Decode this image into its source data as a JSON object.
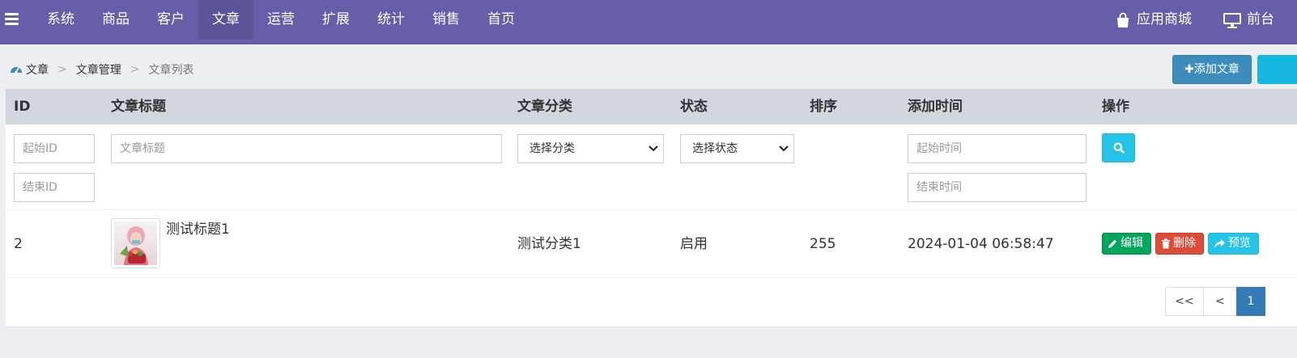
{
  "nav": {
    "items": [
      {
        "label": "系统"
      },
      {
        "label": "商品"
      },
      {
        "label": "客户"
      },
      {
        "label": "文章",
        "active": true
      },
      {
        "label": "运营"
      },
      {
        "label": "扩展"
      },
      {
        "label": "统计"
      },
      {
        "label": "销售"
      },
      {
        "label": "首页"
      }
    ],
    "app_store": "应用商城",
    "frontend": "前台"
  },
  "breadcrumb": {
    "home": "文章",
    "level2": "文章管理",
    "current": "文章列表",
    "separator": ">"
  },
  "actions": {
    "add_article": "添加文章"
  },
  "table": {
    "headers": {
      "id": "ID",
      "title": "文章标题",
      "category": "文章分类",
      "status": "状态",
      "sort": "排序",
      "added_time": "添加时间",
      "operations": "操作"
    },
    "filters": {
      "start_id": "起始ID",
      "end_id": "结束ID",
      "title": "文章标题",
      "category_selected": "选择分类",
      "status_selected": "选择状态",
      "start_time": "起始时间",
      "end_time": "结束时间"
    },
    "rows": [
      {
        "id": "2",
        "title": "测试标题1",
        "category": "测试分类1",
        "status": "启用",
        "sort": "255",
        "added_time": "2024-01-04 06:58:47",
        "edit": "编辑",
        "delete": "删除",
        "preview": "预览"
      }
    ]
  },
  "pagination": {
    "first": "<<",
    "prev": "<",
    "current": "1"
  },
  "colors": {
    "topbar": "#655ea8",
    "primary": "#3c8dbc",
    "info": "#25c3e8",
    "success": "#00a65a",
    "danger": "#dd4b39",
    "page_active": "#337ab7"
  }
}
